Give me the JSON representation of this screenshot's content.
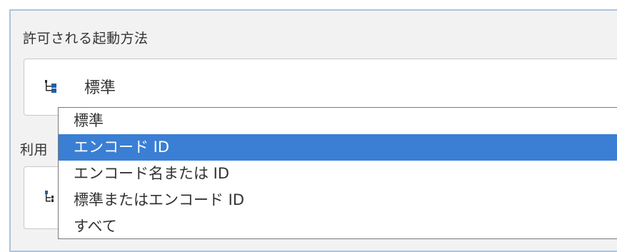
{
  "launch_methods": {
    "label": "許可される起動方法",
    "selected_value": "標準",
    "icon": "tree-structure-icon"
  },
  "second_field": {
    "label": "利用"
  },
  "dropdown": {
    "options": [
      "標準",
      "エンコード ID",
      "エンコード名または ID",
      "標準またはエンコード ID",
      "すべて"
    ],
    "highlighted_index": 1
  },
  "colors": {
    "highlight": "#3a7fd4",
    "panel_border": "#aec3db",
    "icon_blue": "#1e5fa8"
  }
}
